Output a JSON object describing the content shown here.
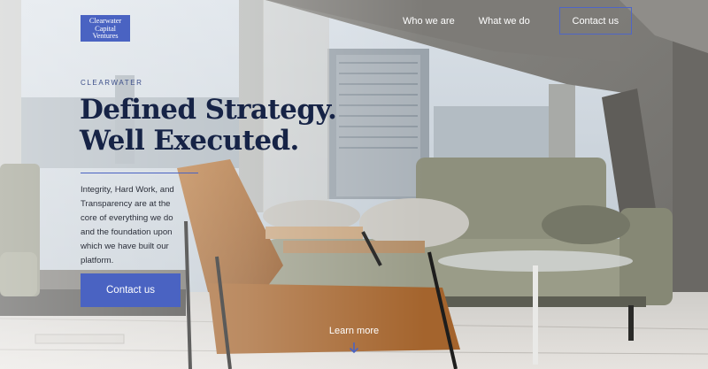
{
  "brand": {
    "logo_lines": [
      "Clearwater",
      "Capital",
      "Ventures"
    ],
    "accent": "#4a63c2",
    "heading_color": "#162346"
  },
  "nav": {
    "links": [
      "Who we are",
      "What we do"
    ],
    "cta_label": "Contact us"
  },
  "hero": {
    "eyebrow": "CLEARWATER",
    "headline_lines": [
      "Defined Strategy.",
      "Well Executed."
    ],
    "body": "Integrity, Hard Work, and Transparency are at the core of everything we do and the foundation upon which we have built our platform.",
    "cta_label": "Contact us"
  },
  "scroll": {
    "label": "Learn more",
    "icon": "arrow-down-icon"
  }
}
